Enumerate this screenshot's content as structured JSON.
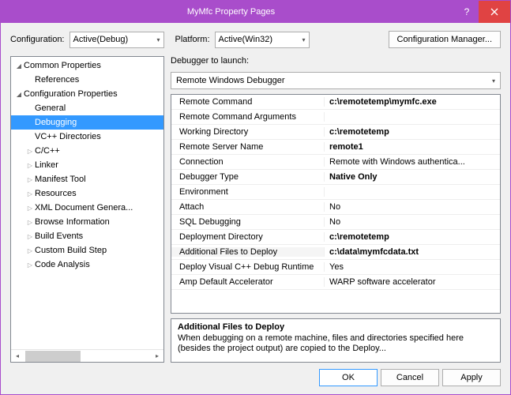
{
  "title": "MyMfc Property Pages",
  "top": {
    "config_lbl": "Configuration:",
    "config_val": "Active(Debug)",
    "platform_lbl": "Platform:",
    "platform_val": "Active(Win32)",
    "cfgmgr": "Configuration Manager..."
  },
  "tree": {
    "common": "Common Properties",
    "references": "References",
    "cfgprops": "Configuration Properties",
    "items": [
      "General",
      "Debugging",
      "VC++ Directories",
      "C/C++",
      "Linker",
      "Manifest Tool",
      "Resources",
      "XML Document Genera...",
      "Browse Information",
      "Build Events",
      "Custom Build Step",
      "Code Analysis"
    ]
  },
  "launcher_lbl": "Debugger to launch:",
  "launcher_val": "Remote Windows Debugger",
  "grid": [
    {
      "k": "Remote Command",
      "v": "c:\\remotetemp\\mymfc.exe",
      "b": true
    },
    {
      "k": "Remote Command Arguments",
      "v": ""
    },
    {
      "k": "Working Directory",
      "v": "c:\\remotetemp",
      "b": true
    },
    {
      "k": "Remote Server Name",
      "v": "remote1",
      "b": true
    },
    {
      "k": "Connection",
      "v": "Remote with Windows authentica..."
    },
    {
      "k": "Debugger Type",
      "v": "Native Only",
      "b": true
    },
    {
      "k": "Environment",
      "v": ""
    },
    {
      "k": "Attach",
      "v": "No"
    },
    {
      "k": "SQL Debugging",
      "v": "No"
    },
    {
      "k": "Deployment Directory",
      "v": "c:\\remotetemp",
      "b": true
    },
    {
      "k": "Additional Files to Deploy",
      "v": "c:\\data\\mymfcdata.txt",
      "b": true,
      "sel": true
    },
    {
      "k": "Deploy Visual C++ Debug Runtime",
      "v": "Yes"
    },
    {
      "k": "Amp Default Accelerator",
      "v": "WARP software accelerator"
    }
  ],
  "desc": {
    "title": "Additional Files to Deploy",
    "text": "When debugging on a remote machine, files and directories specified here (besides the project output) are copied to the Deploy..."
  },
  "footer": {
    "ok": "OK",
    "cancel": "Cancel",
    "apply": "Apply"
  }
}
